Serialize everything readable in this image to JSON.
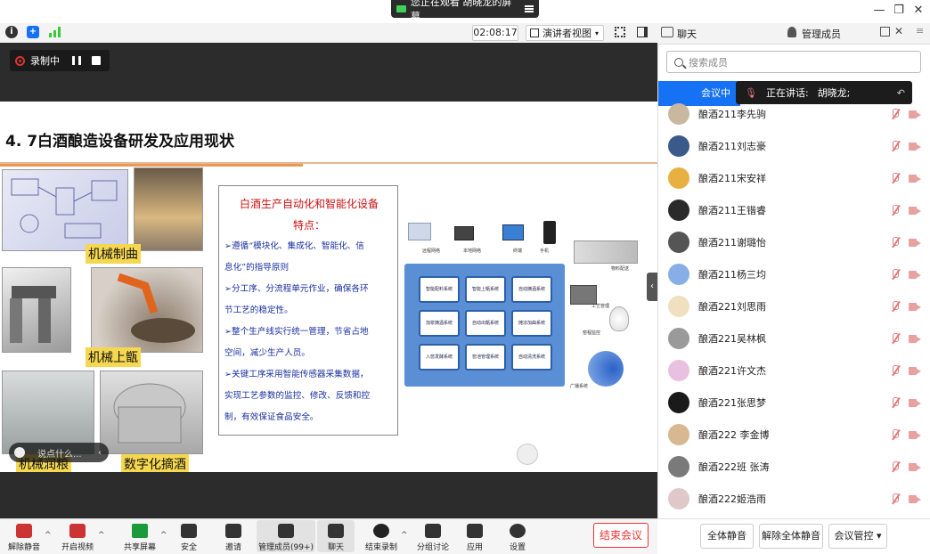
{
  "top": {
    "viewing_text": "您正在观看  胡晓龙的屏幕"
  },
  "toolbar": {
    "timer": "02:08:17",
    "view_mode": "演讲者视图"
  },
  "recording": {
    "label": "录制中"
  },
  "slide": {
    "title": "4. 7白酒酿造设备研发及应用现状",
    "captions": [
      "机械制曲",
      "机械上甑",
      "机械润粮",
      "数字化摘酒"
    ],
    "textbox_title_1": "白酒生产自动化和智能化设备",
    "textbox_title_2": "特点：",
    "textbox_lines": [
      "➢遵循“模块化、集成化、智能化、信",
      "息化”的指导原则",
      "➢分工序、分流程单元作业，确保各环",
      "节工艺的稳定性。",
      "➢整个生产线实行统一管理，节省占地",
      "空间，减少生产人员。",
      "➢关键工序采用智能传感器采集数据，",
      "实现工艺参数的监控、修改、反馈和控",
      "制，有效保证食品安全。"
    ],
    "diagram_boxes": [
      "智能配料系统",
      "智能上甑系统",
      "自动摘酒系统",
      "加浆摘酒系统",
      "自动出甑系统",
      "摊凉加曲系统",
      "入窖发酵系统",
      "窖池管理系统",
      "自动清洗系统"
    ],
    "diagram_labels": [
      "远程网络",
      "本地网络",
      "终端",
      "手机",
      "物料配送",
      "工艺管理",
      "窑程监控",
      "广播系统"
    ]
  },
  "chat_bubble": {
    "placeholder": "说点什么..."
  },
  "right_panel": {
    "tab_chat": "聊天",
    "tab_members": "管理成员",
    "search_placeholder": "搜索成员",
    "meeting_tab": "会议中(2",
    "speaking_label": "正在讲话:",
    "speaking_name": "胡晓龙;",
    "members": [
      {
        "name": "酿酒211李先驹",
        "color": "#c9b8a0"
      },
      {
        "name": "酿酒211刘志豪",
        "color": "#3a5a8a"
      },
      {
        "name": "酿酒211宋安祥",
        "color": "#e8b040"
      },
      {
        "name": "酿酒211王锴睿",
        "color": "#2a2a2a"
      },
      {
        "name": "酿酒211谢璐怡",
        "color": "#555555"
      },
      {
        "name": "酿酒211杨三均",
        "color": "#88aee8"
      },
      {
        "name": "酿酒221刘思雨",
        "color": "#f0e0c0"
      },
      {
        "name": "酿酒221吴林枫",
        "color": "#9a9a9a"
      },
      {
        "name": "酿酒221许文杰",
        "color": "#e8c0e0"
      },
      {
        "name": "酿酒221张思梦",
        "color": "#1a1a1a"
      },
      {
        "name": "酿酒222  李金博",
        "color": "#d8b890"
      },
      {
        "name": "酿酒222班 张涛",
        "color": "#7a7a7a"
      },
      {
        "name": "酿酒222姬浩雨",
        "color": "#e0c8c8"
      }
    ],
    "btn_mute_all": "全体静音",
    "btn_unmute_all": "解除全体静音",
    "btn_control": "会议管控"
  },
  "bottom_toolbar": {
    "items": [
      "解除静音",
      "开启视频",
      "共享屏幕",
      "安全",
      "邀请",
      "管理成员(99+)",
      "聊天",
      "结束录制",
      "分组讨论",
      "应用",
      "设置"
    ],
    "end_meeting": "结束会议"
  },
  "colors": {
    "accent": "#1672f5",
    "end_red": "#e33333",
    "mic_off": "#e07a7a"
  }
}
